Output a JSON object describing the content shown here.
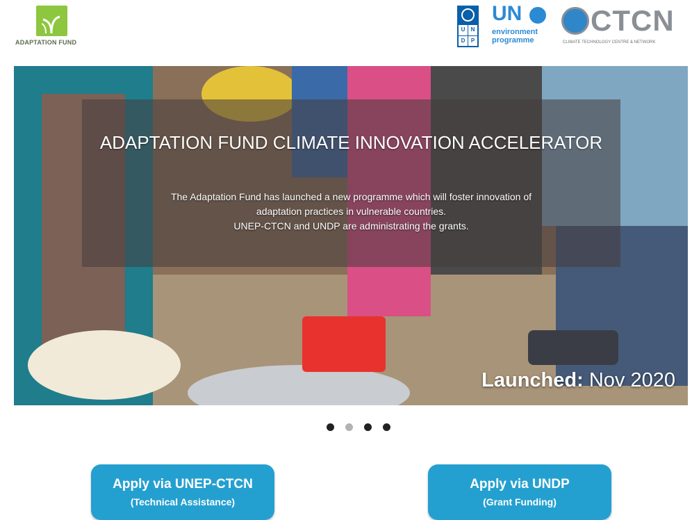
{
  "header": {
    "adaptation_fund_logo_text": "ADAPTATION FUND",
    "undp_logo_letters": [
      "U",
      "N",
      "D",
      "P"
    ],
    "unep_logo": {
      "un": "UN",
      "line1": "environment",
      "line2": "programme"
    },
    "ctcn_logo": {
      "word": "CTCN",
      "sub": "CLIMATE TECHNOLOGY CENTRE & NETWORK"
    }
  },
  "hero": {
    "title": "ADAPTATION FUND CLIMATE INNOVATION ACCELERATOR",
    "body_line1": "The Adaptation Fund has launched a new programme which will foster innovation of",
    "body_line2": "adaptation practices in vulnerable countries.",
    "body_line3": "UNEP-CTCN and UNDP are administrating the grants.",
    "launched_label": "Launched:",
    "launched_value": "Nov 2020"
  },
  "carousel": {
    "slide_count": 4,
    "active_index": 1
  },
  "buttons": {
    "unep": {
      "label": "Apply via UNEP-CTCN",
      "sub": "(Technical Assistance)"
    },
    "undp": {
      "label": "Apply via UNDP",
      "sub": "(Grant Funding)"
    }
  },
  "colors": {
    "button": "#24a0d0",
    "af_green": "#8dc63f",
    "undp_blue": "#0a5fa8",
    "unep_blue": "#2b8ad4",
    "ctcn_grey": "#8a8f96"
  }
}
